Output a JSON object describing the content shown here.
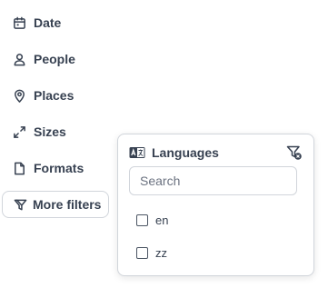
{
  "filters": {
    "date": {
      "label": "Date",
      "icon": "calendar-icon"
    },
    "people": {
      "label": "People",
      "icon": "person-icon"
    },
    "places": {
      "label": "Places",
      "icon": "map-pin-icon"
    },
    "sizes": {
      "label": "Sizes",
      "icon": "expand-icon"
    },
    "formats": {
      "label": "Formats",
      "icon": "file-icon"
    }
  },
  "more_filters": {
    "label": "More filters",
    "icon": "filter-icon"
  },
  "languages_popover": {
    "title": "Languages",
    "title_icon": "language-icon",
    "clear_icon": "filter-clear-icon",
    "search_placeholder": "Search",
    "search_value": "",
    "options": [
      {
        "label": "en",
        "checked": false
      },
      {
        "label": "zz",
        "checked": false
      }
    ]
  },
  "colors": {
    "text": "#374151",
    "border": "#d1d5db",
    "background": "#ffffff"
  }
}
